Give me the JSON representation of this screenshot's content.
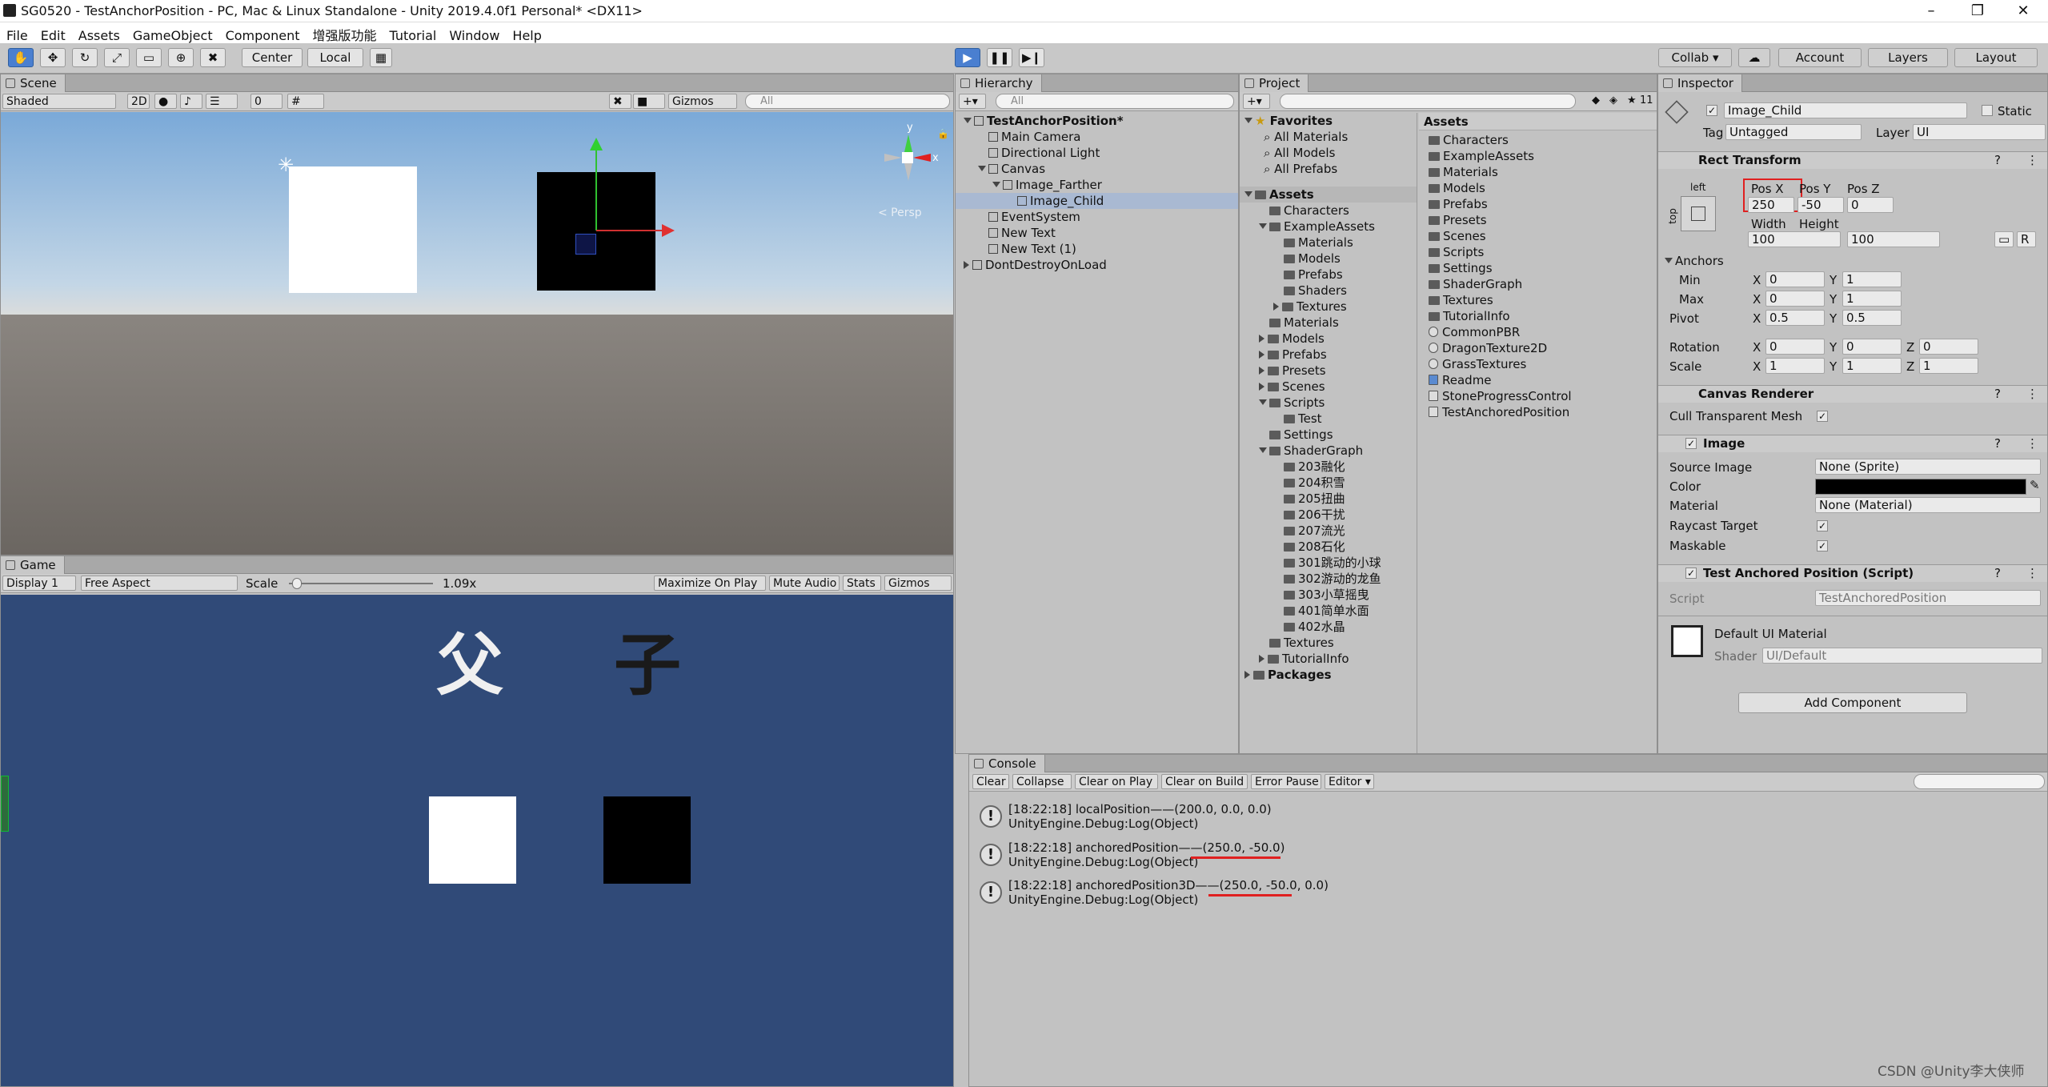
{
  "window": {
    "title": "SG0520 - TestAnchorPosition - PC, Mac & Linux Standalone - Unity 2019.4.0f1 Personal* <DX11>",
    "minimize": "–",
    "maximize": "❐",
    "close": "✕"
  },
  "menu": [
    "File",
    "Edit",
    "Assets",
    "GameObject",
    "Component",
    "增强版功能",
    "Tutorial",
    "Window",
    "Help"
  ],
  "toolbar": {
    "pivot_center": "Center",
    "pivot_local": "Local",
    "collab": "Collab ▾",
    "account": "Account",
    "layers": "Layers",
    "layout": "Layout"
  },
  "scene": {
    "tab": "Scene",
    "shading": "Shaded",
    "mode2d": "2D",
    "fx_count": "0",
    "gizmos": "Gizmos",
    "search_placeholder": "All",
    "persp": "< Persp",
    "axis_y": "y",
    "axis_x": "x"
  },
  "game": {
    "tab": "Game",
    "display": "Display 1",
    "aspect": "Free Aspect",
    "scale_label": "Scale",
    "scale_value": "1.09x",
    "max_on_play": "Maximize On Play",
    "mute": "Mute Audio",
    "stats": "Stats",
    "gizmos": "Gizmos",
    "label_father": "父",
    "label_child": "子"
  },
  "hierarchy": {
    "tab": "Hierarchy",
    "search_placeholder": "All",
    "items": [
      {
        "label": "TestAnchorPosition*",
        "depth": 0,
        "kind": "scene",
        "expanded": true,
        "bold": true
      },
      {
        "label": "Main Camera",
        "depth": 1,
        "kind": "go"
      },
      {
        "label": "Directional Light",
        "depth": 1,
        "kind": "go"
      },
      {
        "label": "Canvas",
        "depth": 1,
        "kind": "go",
        "expanded": true
      },
      {
        "label": "Image_Farther",
        "depth": 2,
        "kind": "go",
        "expanded": true
      },
      {
        "label": "Image_Child",
        "depth": 3,
        "kind": "go",
        "selected": true
      },
      {
        "label": "EventSystem",
        "depth": 1,
        "kind": "go"
      },
      {
        "label": "New Text",
        "depth": 1,
        "kind": "go"
      },
      {
        "label": "New Text (1)",
        "depth": 1,
        "kind": "go"
      },
      {
        "label": "DontDestroyOnLoad",
        "depth": 0,
        "kind": "scene",
        "collapsed": true
      }
    ]
  },
  "project": {
    "tab": "Project",
    "hidden_count": "11",
    "favorites": {
      "label": "Favorites",
      "items": [
        "All Materials",
        "All Models",
        "All Prefabs"
      ]
    },
    "tree": [
      {
        "label": "Assets",
        "depth": 0,
        "bold": true,
        "expanded": true,
        "selected": true
      },
      {
        "label": "Characters",
        "depth": 1
      },
      {
        "label": "ExampleAssets",
        "depth": 1,
        "expanded": true
      },
      {
        "label": "Materials",
        "depth": 2
      },
      {
        "label": "Models",
        "depth": 2
      },
      {
        "label": "Prefabs",
        "depth": 2
      },
      {
        "label": "Shaders",
        "depth": 2
      },
      {
        "label": "Textures",
        "depth": 2,
        "collapsed": true
      },
      {
        "label": "Materials",
        "depth": 1
      },
      {
        "label": "Models",
        "depth": 1,
        "collapsed": true
      },
      {
        "label": "Prefabs",
        "depth": 1,
        "collapsed": true
      },
      {
        "label": "Presets",
        "depth": 1,
        "collapsed": true
      },
      {
        "label": "Scenes",
        "depth": 1,
        "collapsed": true
      },
      {
        "label": "Scripts",
        "depth": 1,
        "expanded": true
      },
      {
        "label": "Test",
        "depth": 2
      },
      {
        "label": "Settings",
        "depth": 1
      },
      {
        "label": "ShaderGraph",
        "depth": 1,
        "expanded": true
      },
      {
        "label": "203融化",
        "depth": 2
      },
      {
        "label": "204积雪",
        "depth": 2
      },
      {
        "label": "205扭曲",
        "depth": 2
      },
      {
        "label": "206干扰",
        "depth": 2
      },
      {
        "label": "207流光",
        "depth": 2
      },
      {
        "label": "208石化",
        "depth": 2
      },
      {
        "label": "301跳动的小球",
        "depth": 2
      },
      {
        "label": "302游动的龙鱼",
        "depth": 2
      },
      {
        "label": "303小草摇曳",
        "depth": 2
      },
      {
        "label": "401简单水面",
        "depth": 2
      },
      {
        "label": "402水晶",
        "depth": 2
      },
      {
        "label": "Textures",
        "depth": 1
      },
      {
        "label": "TutorialInfo",
        "depth": 1,
        "collapsed": true
      },
      {
        "label": "Packages",
        "depth": 0,
        "bold": true,
        "collapsed": true
      }
    ],
    "assets_header": "Assets",
    "assets": [
      {
        "label": "Characters",
        "kind": "folder"
      },
      {
        "label": "ExampleAssets",
        "kind": "folder"
      },
      {
        "label": "Materials",
        "kind": "folder"
      },
      {
        "label": "Models",
        "kind": "folder"
      },
      {
        "label": "Prefabs",
        "kind": "folder"
      },
      {
        "label": "Presets",
        "kind": "folder"
      },
      {
        "label": "Scenes",
        "kind": "folder"
      },
      {
        "label": "Scripts",
        "kind": "folder"
      },
      {
        "label": "Settings",
        "kind": "folder"
      },
      {
        "label": "ShaderGraph",
        "kind": "folder"
      },
      {
        "label": "Textures",
        "kind": "folder"
      },
      {
        "label": "TutorialInfo",
        "kind": "folder"
      },
      {
        "label": "CommonPBR",
        "kind": "material"
      },
      {
        "label": "DragonTexture2D",
        "kind": "material"
      },
      {
        "label": "GrassTextures",
        "kind": "material"
      },
      {
        "label": "Readme",
        "kind": "readme"
      },
      {
        "label": "StoneProgressControl",
        "kind": "script"
      },
      {
        "label": "TestAnchoredPosition",
        "kind": "script"
      }
    ]
  },
  "inspector": {
    "tab": "Inspector",
    "object_name": "Image_Child",
    "static": "Static",
    "tag_label": "Tag",
    "tag_value": "Untagged",
    "layer_label": "Layer",
    "layer_value": "UI",
    "rect_transform": "Rect Transform",
    "anchor_h": "left",
    "anchor_v": "top",
    "pos_x_label": "Pos X",
    "pos_y_label": "Pos Y",
    "pos_z_label": "Pos Z",
    "pos_x": "250",
    "pos_y": "-50",
    "pos_z": "0",
    "width_label": "Width",
    "height_label": "Height",
    "width": "100",
    "height": "100",
    "anchors": "Anchors",
    "min": "Min",
    "max": "Max",
    "min_x": "0",
    "min_y": "1",
    "max_x": "0",
    "max_y": "1",
    "pivot": "Pivot",
    "pivot_x": "0.5",
    "pivot_y": "0.5",
    "rotation": "Rotation",
    "rot_x": "0",
    "rot_y": "0",
    "rot_z": "0",
    "scale": "Scale",
    "scale_x": "1",
    "scale_y": "1",
    "scale_z": "1",
    "x": "X",
    "y": "Y",
    "z": "Z",
    "r": "R",
    "canvas_renderer": "Canvas Renderer",
    "cull": "Cull Transparent Mesh",
    "image": "Image",
    "source_image": "Source Image",
    "source_image_value": "None (Sprite)",
    "color": "Color",
    "material": "Material",
    "material_value": "None (Material)",
    "raycast": "Raycast Target",
    "maskable": "Maskable",
    "script_comp": "Test Anchored Position (Script)",
    "script_label": "Script",
    "script_value": "TestAnchoredPosition",
    "default_mat": "Default UI Material",
    "shader_label": "Shader",
    "shader_value": "UI/Default",
    "add_component": "Add Component",
    "check": "✓",
    "help": "?",
    "settings": "⋮"
  },
  "console": {
    "tab": "Console",
    "buttons": [
      "Clear",
      "Collapse",
      "Clear on Play",
      "Clear on Build",
      "Error Pause",
      "Editor ▾"
    ],
    "logs": [
      {
        "line1": "[18:22:18] localPosition——(200.0, 0.0, 0.0)",
        "line2": "UnityEngine.Debug:Log(Object)"
      },
      {
        "line1": "[18:22:18] anchoredPosition——(250.0, -50.0)",
        "line2": "UnityEngine.Debug:Log(Object)"
      },
      {
        "line1": "[18:22:18] anchoredPosition3D——(250.0, -50.0, 0.0)",
        "line2": "UnityEngine.Debug:Log(Object)"
      }
    ]
  },
  "watermark": "CSDN @Unity李大侠师",
  "colors": {
    "selection_blue": "#4a7fd0",
    "highlight_red": "#e02020",
    "game_bg": "#304a78"
  }
}
